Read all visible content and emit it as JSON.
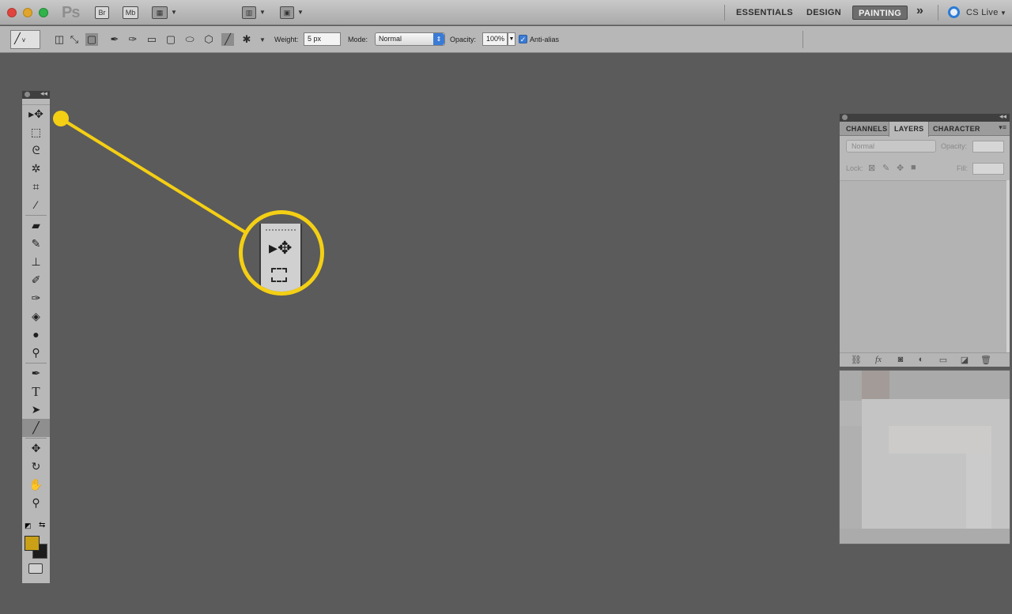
{
  "app": {
    "logo": "Ps",
    "bridge_label": "Br",
    "minibridge_label": "Mb"
  },
  "workspaces": {
    "essentials": "ESSENTIALS",
    "design": "DESIGN",
    "painting": "PAINTING",
    "more": "»",
    "cs_live": "CS Live"
  },
  "options": {
    "weight_label": "Weight:",
    "weight_value": "5 px",
    "mode_label": "Mode:",
    "mode_value": "Normal",
    "opacity_label": "Opacity:",
    "opacity_value": "100%",
    "antialias_label": "Anti-alias",
    "antialias_checked": true
  },
  "tools": [
    {
      "name": "move-tool",
      "icon": "move-icon",
      "glyph": "▸✥"
    },
    {
      "name": "marquee-tool",
      "icon": "marquee-icon",
      "glyph": "⬚"
    },
    {
      "name": "lasso-tool",
      "icon": "lasso-icon",
      "glyph": "ᘓ"
    },
    {
      "name": "quick-selection-tool",
      "icon": "magic-wand-icon",
      "glyph": "✲"
    },
    {
      "name": "crop-tool",
      "icon": "crop-icon",
      "glyph": "⌗"
    },
    {
      "name": "eyedropper-tool",
      "icon": "eyedropper-icon",
      "glyph": "⁄"
    },
    {
      "name": "healing-brush-tool",
      "icon": "bandage-icon",
      "glyph": "▰"
    },
    {
      "name": "brush-tool",
      "icon": "brush-icon",
      "glyph": "✎"
    },
    {
      "name": "clone-stamp-tool",
      "icon": "stamp-icon",
      "glyph": "⊥"
    },
    {
      "name": "history-brush-tool",
      "icon": "history-brush-icon",
      "glyph": "✐"
    },
    {
      "name": "eraser-tool",
      "icon": "eraser-icon",
      "glyph": "✑"
    },
    {
      "name": "paint-bucket-tool",
      "icon": "paint-bucket-icon",
      "glyph": "◈"
    },
    {
      "name": "blur-tool",
      "icon": "blur-drop-icon",
      "glyph": "●"
    },
    {
      "name": "dodge-tool",
      "icon": "dodge-icon",
      "glyph": "⚲"
    },
    {
      "name": "pen-tool",
      "icon": "pen-icon",
      "glyph": "✒"
    },
    {
      "name": "type-tool",
      "icon": "type-icon",
      "glyph": "T"
    },
    {
      "name": "path-selection-tool",
      "icon": "arrow-icon",
      "glyph": "➤"
    },
    {
      "name": "line-tool",
      "icon": "line-icon",
      "glyph": "╱"
    },
    {
      "name": "3d-rotate-tool",
      "icon": "3d-rotate-icon",
      "glyph": "✥"
    },
    {
      "name": "3d-orbit-tool",
      "icon": "3d-orbit-icon",
      "glyph": "↻"
    },
    {
      "name": "hand-tool",
      "icon": "hand-icon",
      "glyph": "✋"
    },
    {
      "name": "zoom-tool",
      "icon": "zoom-icon",
      "glyph": "⚲"
    }
  ],
  "colors": {
    "foreground": "#c9a016",
    "background": "#1c1c1c",
    "callout": "#f4cf14"
  },
  "layers_panel": {
    "tabs": [
      "CHANNELS",
      "LAYERS",
      "CHARACTER"
    ],
    "active_tab": "LAYERS",
    "blend_mode": "Normal",
    "opacity_label": "Opacity:",
    "lock_label": "Lock:",
    "fill_label": "Fill:",
    "footer_icons": [
      "link-icon",
      "fx-icon",
      "mask-icon",
      "adjustment-icon",
      "group-folder-icon",
      "new-layer-icon",
      "trash-icon"
    ]
  }
}
